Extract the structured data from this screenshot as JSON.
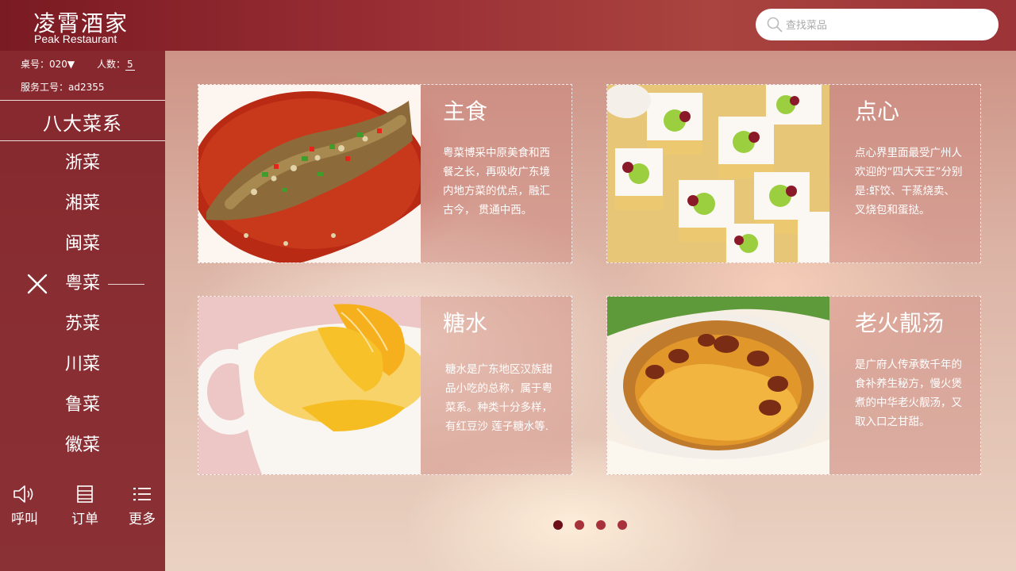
{
  "brand": {
    "name_cn": "凌霄酒家",
    "name_en": "Peak Restaurant"
  },
  "search": {
    "placeholder": "查找菜品"
  },
  "info": {
    "table_label": "桌号：",
    "table_value": "020",
    "people_label": "人数：",
    "people_value": "5",
    "staff_label": "服务工号：",
    "staff_value": "ad2355"
  },
  "category_title": "八大菜系",
  "cuisines": [
    {
      "label": "浙菜"
    },
    {
      "label": "湘菜"
    },
    {
      "label": "闽菜"
    },
    {
      "label": "粤菜",
      "active": true
    },
    {
      "label": "苏菜"
    },
    {
      "label": "川菜"
    },
    {
      "label": "鲁菜"
    },
    {
      "label": "徽菜"
    }
  ],
  "tools": {
    "call": "呼叫",
    "order": "订单",
    "more": "更多"
  },
  "cards": [
    {
      "title": "主食",
      "desc": "粤菜博采中原美食和西餐之长，再吸收广东境内地方菜的优点，融汇古今， 贯通中西。"
    },
    {
      "title": "点心",
      "desc": "点心界里面最受广州人欢迎的“四大天王”分别是:虾饺、干蒸烧卖、叉烧包和蛋挞。"
    },
    {
      "title": "糖水",
      "desc": "糖水是广东地区汉族甜品小吃的总称，属于粤菜系。种类十分多样，有红豆沙 莲子糖水等."
    },
    {
      "title": "老火靓汤",
      "desc": "是广府人传承数千年的食补养生秘方，慢火煲煮的中华老火靓汤，又取入口之甘甜。"
    }
  ],
  "pagination": {
    "count": 4,
    "active_index": 0
  },
  "colors": {
    "sidebar": "#7a161e",
    "accent": "#a8323c",
    "dot_active": "#6d0f18"
  }
}
